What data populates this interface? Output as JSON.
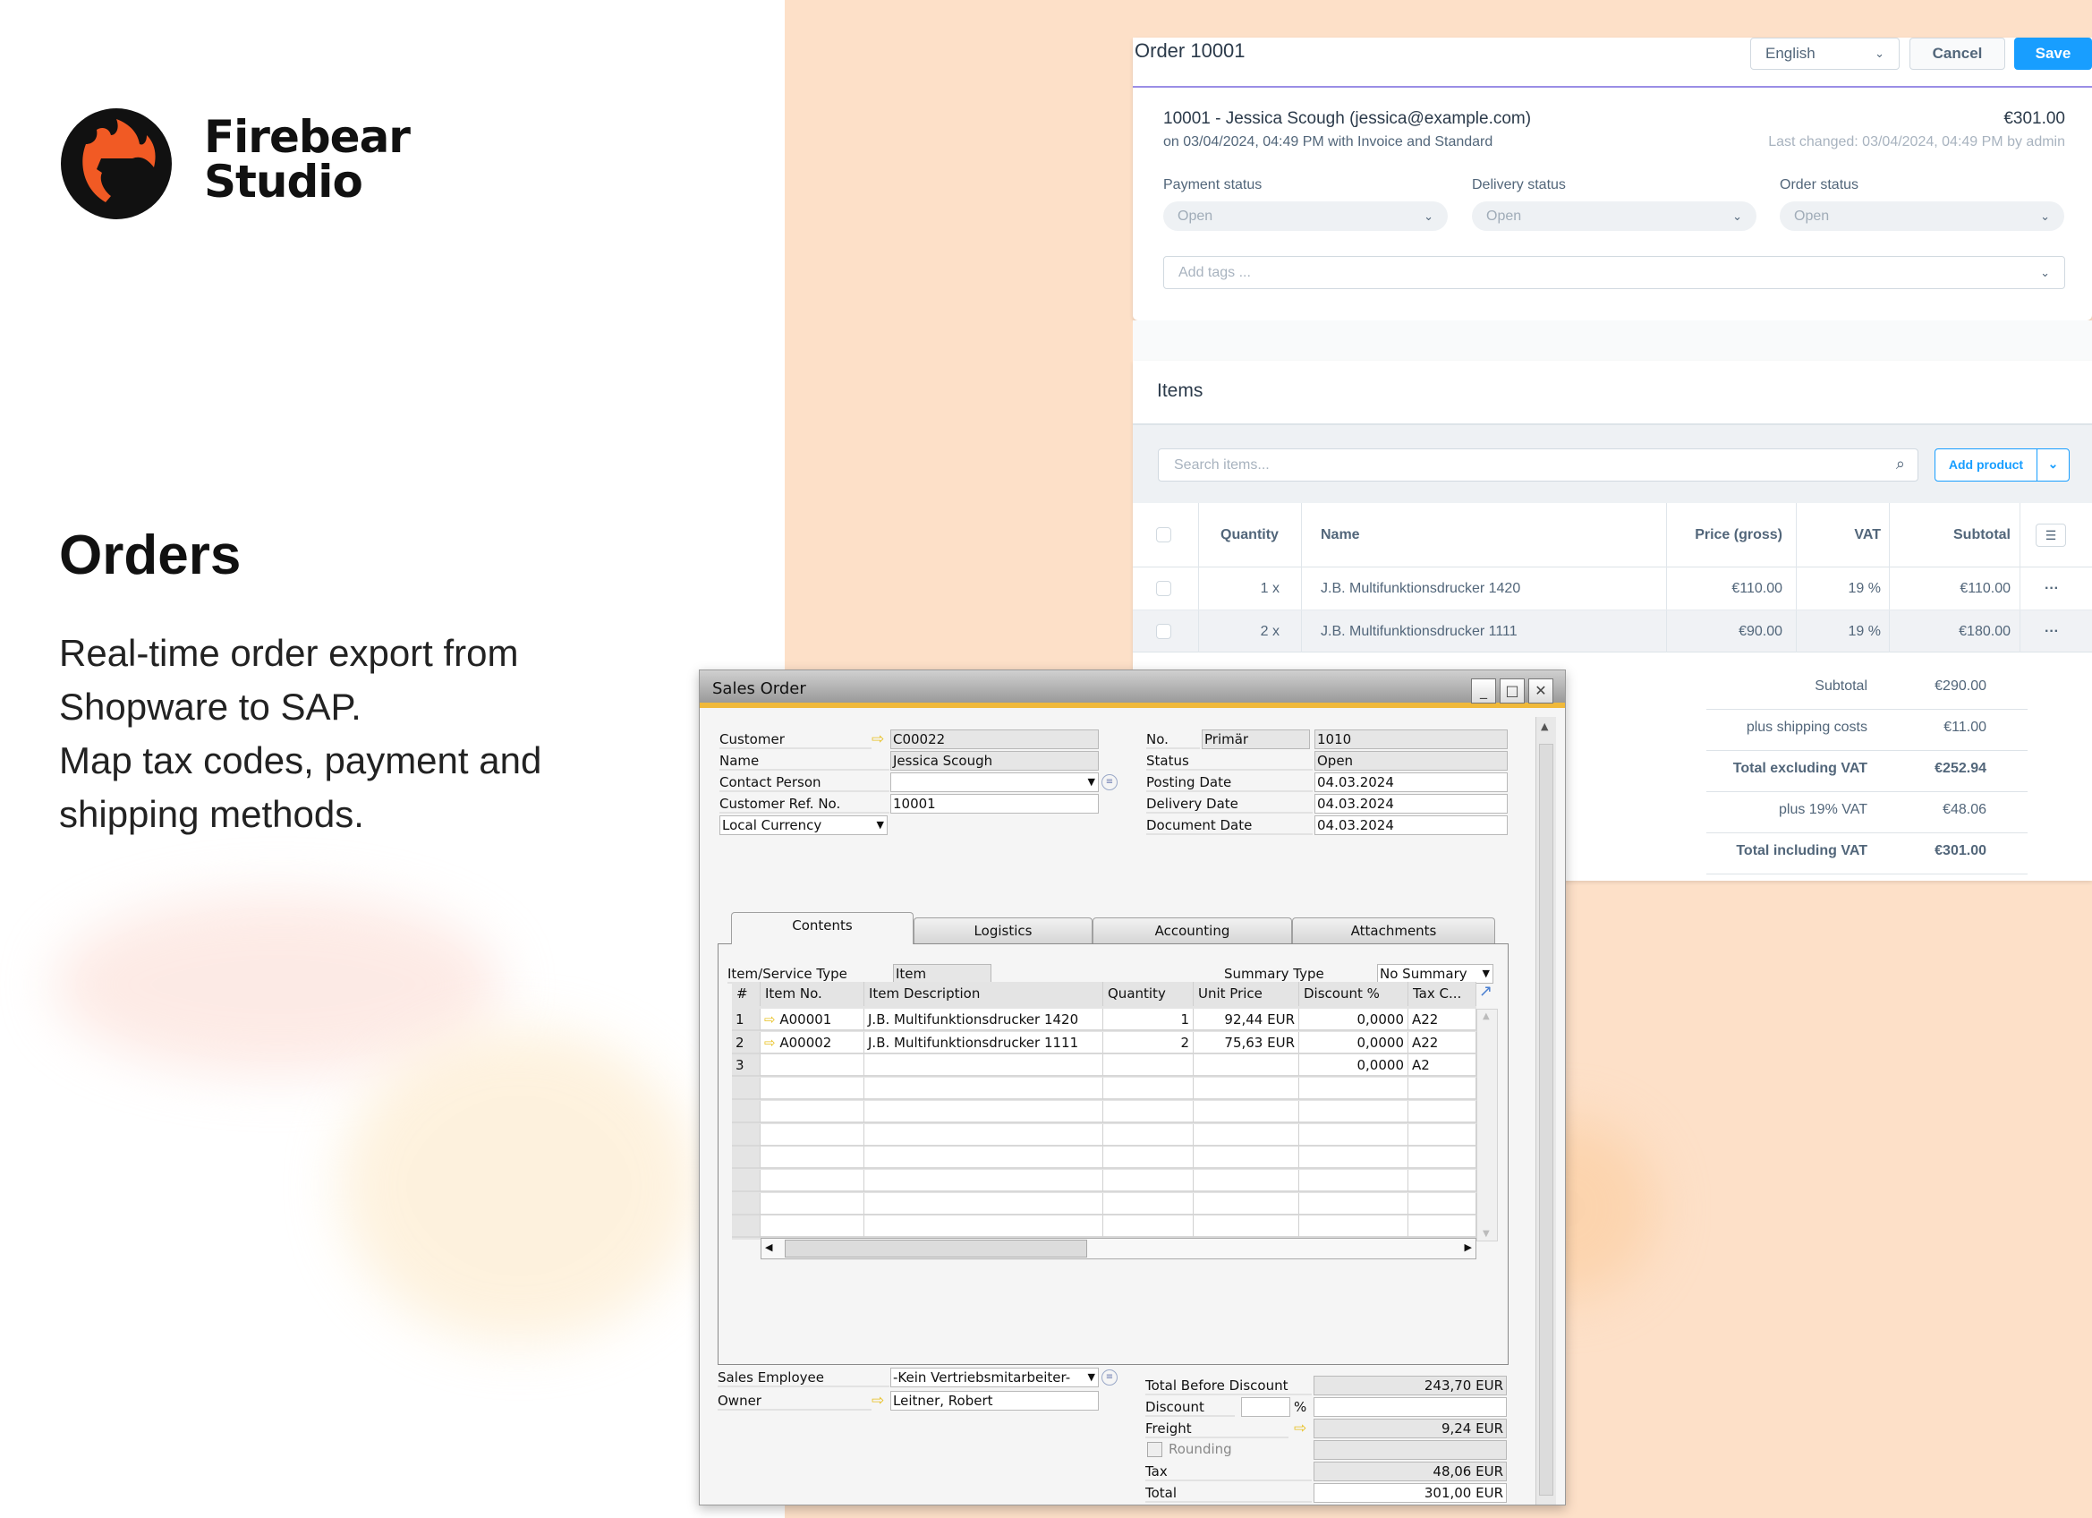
{
  "brand": {
    "name_line1": "Firebear",
    "name_line2": "Studio",
    "logo_colors": {
      "circle": "#111111",
      "flame": "#f15a24"
    }
  },
  "hero": {
    "title": "Orders",
    "lines": [
      "Real-time order export from",
      "Shopware to SAP.",
      "Map tax codes, payment and",
      "shipping methods."
    ]
  },
  "colors": {
    "peach": "#fde0c8",
    "shopware_blue": "#189eff",
    "accent_line": "#9a8ee6",
    "sap_gold": "#f0b93a"
  },
  "shopware": {
    "title": "Order 10001",
    "language": "English",
    "cancel": "Cancel",
    "save": "Save",
    "customer_line": "10001 - Jessica Scough (jessica@example.com)",
    "total": "€301.00",
    "sub_line": "on 03/04/2024, 04:49 PM with Invoice and Standard",
    "last_changed": "Last changed: 03/04/2024, 04:49 PM by admin",
    "statuses": [
      {
        "label": "Payment status",
        "value": "Open"
      },
      {
        "label": "Delivery status",
        "value": "Open"
      },
      {
        "label": "Order status",
        "value": "Open"
      }
    ],
    "tags_placeholder": "Add tags ...",
    "items_title": "Items",
    "search_placeholder": "Search items...",
    "add_product": "Add product",
    "columns": [
      "Quantity",
      "Name",
      "Price (gross)",
      "VAT",
      "Subtotal"
    ],
    "rows": [
      {
        "qty": "1 x",
        "name": "J.B. Multifunktionsdrucker 1420",
        "price": "€110.00",
        "vat": "19 %",
        "subtotal": "€110.00"
      },
      {
        "qty": "2 x",
        "name": "J.B. Multifunktionsdrucker 1111",
        "price": "€90.00",
        "vat": "19 %",
        "subtotal": "€180.00"
      }
    ],
    "totals": [
      {
        "label": "Subtotal",
        "value": "€290.00",
        "bold": false
      },
      {
        "label": "plus shipping costs",
        "value": "€11.00",
        "bold": false
      },
      {
        "label": "Total excluding VAT",
        "value": "€252.94",
        "bold": true
      },
      {
        "label": "plus 19% VAT",
        "value": "€48.06",
        "bold": false
      },
      {
        "label": "Total including VAT",
        "value": "€301.00",
        "bold": true
      }
    ]
  },
  "sap": {
    "title": "Sales Order",
    "customer_label": "Customer",
    "customer": "C00022",
    "name_label": "Name",
    "name": "Jessica Scough",
    "contact_label": "Contact Person",
    "contact": "",
    "ref_label": "Customer Ref. No.",
    "ref": "10001",
    "currency": "Local Currency",
    "no_label": "No.",
    "series": "Primär",
    "no": "1010",
    "status_label": "Status",
    "status": "Open",
    "posting_label": "Posting Date",
    "posting": "04.03.2024",
    "delivery_label": "Delivery Date",
    "delivery": "04.03.2024",
    "document_label": "Document Date",
    "document": "04.03.2024",
    "tabs": [
      "Contents",
      "Logistics",
      "Accounting",
      "Attachments"
    ],
    "item_type_label": "Item/Service Type",
    "item_type": "Item",
    "summary_label": "Summary Type",
    "summary": "No Summary",
    "grid_columns": [
      "#",
      "Item No.",
      "Item Description",
      "Quantity",
      "Unit Price",
      "Discount %",
      "Tax C..."
    ],
    "grid_rows": [
      [
        "1",
        "A00001",
        "J.B. Multifunktionsdrucker 1420",
        "1",
        "92,44 EUR",
        "0,0000",
        "A22"
      ],
      [
        "2",
        "A00002",
        "J.B. Multifunktionsdrucker 1111",
        "2",
        "75,63 EUR",
        "0,0000",
        "A22"
      ],
      [
        "3",
        "",
        "",
        "",
        "",
        "0,0000",
        "A2"
      ]
    ],
    "sales_employee_label": "Sales Employee",
    "sales_employee": "-Kein Vertriebsmitarbeiter-",
    "owner_label": "Owner",
    "owner": "Leitner, Robert",
    "total_before_label": "Total Before Discount",
    "total_before": "243,70 EUR",
    "discount_label": "Discount",
    "discount_pct": "",
    "discount_pct_sign": "%",
    "discount": "",
    "freight_label": "Freight",
    "freight": "9,24 EUR",
    "rounding_label": "Rounding",
    "rounding": "",
    "tax_label": "Tax",
    "tax": "48,06 EUR",
    "total_label": "Total",
    "total": "301,00 EUR"
  }
}
